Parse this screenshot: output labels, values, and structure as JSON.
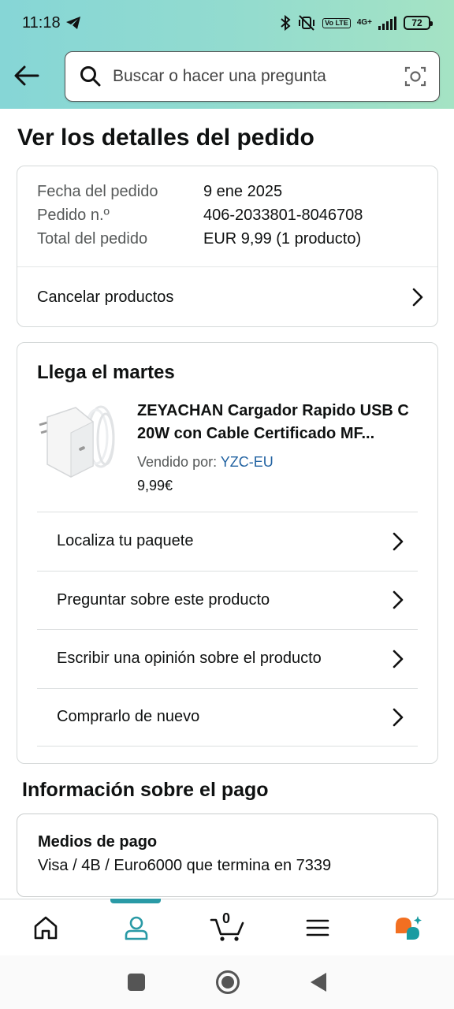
{
  "status_bar": {
    "time": "11:18",
    "battery": "72",
    "volte": "Vo LTE",
    "network": "4G+"
  },
  "search": {
    "placeholder": "Buscar o hacer una pregunta"
  },
  "page_title": "Ver los detalles del pedido",
  "order_info": {
    "date_label": "Fecha del pedido",
    "date_value": "9 ene 2025",
    "number_label": "Pedido n.º",
    "number_value": "406-2033801-8046708",
    "total_label": "Total del pedido",
    "total_value": "EUR 9,99 (1 producto)",
    "cancel_label": "Cancelar productos"
  },
  "shipment": {
    "arrival": "Llega el martes",
    "product_title": "ZEYACHAN Cargador Rapido USB C 20W con Cable Certificado MF...",
    "seller_label": "Vendido por: ",
    "seller_name": "YZC-EU",
    "price": "9,99€",
    "actions": [
      "Localiza tu paquete",
      "Preguntar sobre este producto",
      "Escribir una opinión sobre el producto",
      "Comprarlo de nuevo"
    ]
  },
  "payment": {
    "section_title": "Información sobre el pago",
    "method_title": "Medios de pago",
    "method_value": "Visa / 4B / Euro6000  que termina en 7339"
  },
  "bottom_nav": {
    "cart_count": "0",
    "icons": [
      "home-icon",
      "account-icon",
      "cart-icon",
      "menu-icon",
      "rufus-icon"
    ]
  },
  "colors": {
    "header_gradient": [
      "#86d6d6",
      "#a5e3c4"
    ],
    "link": "#2162a1",
    "active_tab": "#2a9aa6",
    "rufus_orange": "#f26f21",
    "rufus_teal": "#1a9ba1"
  }
}
